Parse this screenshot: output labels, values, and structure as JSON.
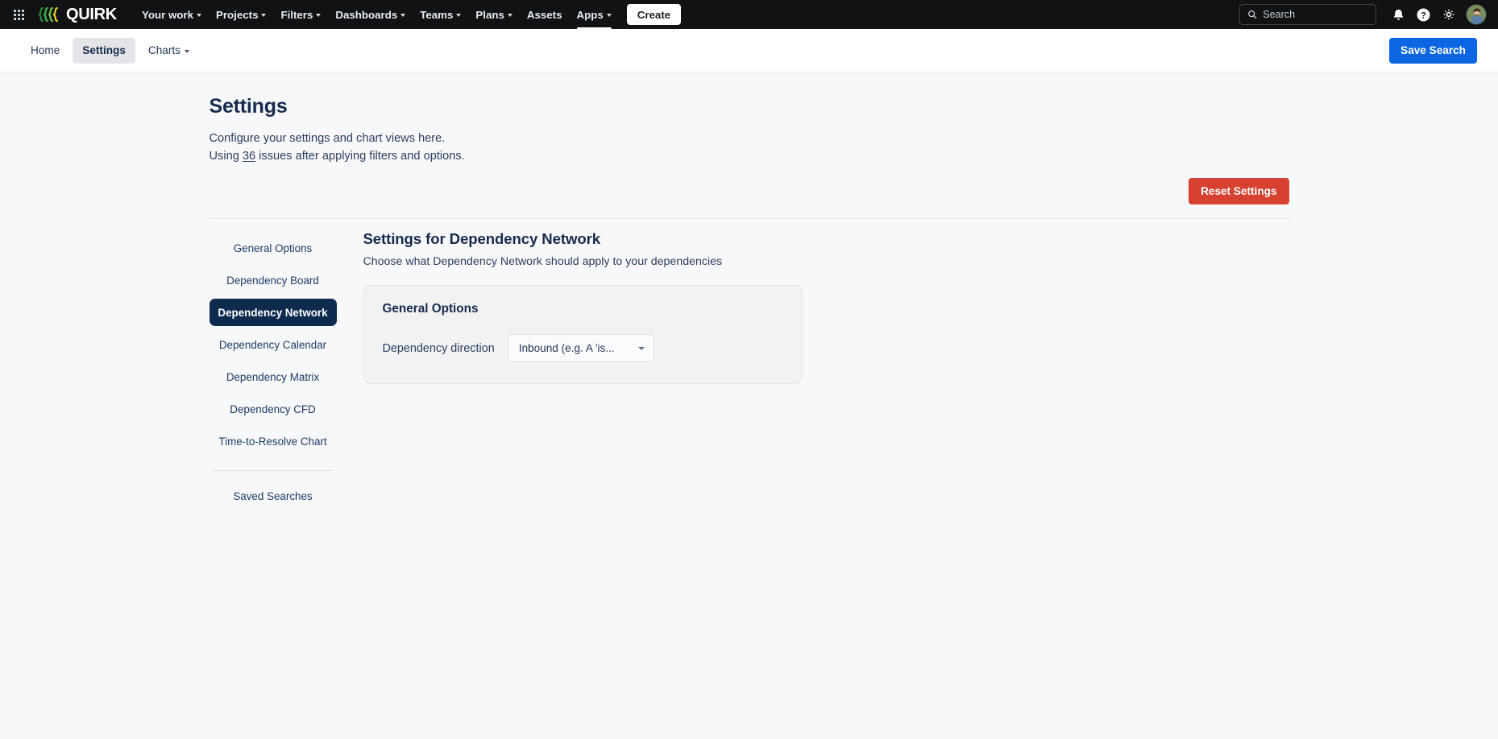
{
  "topnav": {
    "app_switcher_icon": "grid-apps-icon",
    "brand_name": "QUIRK",
    "brand_mark_icon": "quirk-logo-mark",
    "brand_colors": {
      "green": "#3bb143",
      "yellow": "#e8d63a",
      "dark_green": "#1f7a2e"
    },
    "items": [
      {
        "label": "Your work",
        "has_caret": true,
        "active": false
      },
      {
        "label": "Projects",
        "has_caret": true,
        "active": false
      },
      {
        "label": "Filters",
        "has_caret": true,
        "active": false
      },
      {
        "label": "Dashboards",
        "has_caret": true,
        "active": false
      },
      {
        "label": "Teams",
        "has_caret": true,
        "active": false
      },
      {
        "label": "Plans",
        "has_caret": true,
        "active": false
      },
      {
        "label": "Assets",
        "has_caret": false,
        "active": false
      },
      {
        "label": "Apps",
        "has_caret": true,
        "active": true
      }
    ],
    "create_label": "Create",
    "search": {
      "placeholder": "Search",
      "value": "",
      "icon": "search-icon"
    },
    "notifications_icon": "bell-icon",
    "help_icon": "help-circle-icon",
    "settings_icon": "gear-icon",
    "avatar_icon": "user-avatar",
    "background": "#101214"
  },
  "subnav": {
    "items": [
      {
        "label": "Home",
        "has_caret": false,
        "active": false
      },
      {
        "label": "Settings",
        "has_caret": false,
        "active": true
      },
      {
        "label": "Charts",
        "has_caret": true,
        "active": false
      }
    ],
    "save_search_label": "Save Search",
    "save_search_color": "#0c66e4"
  },
  "page": {
    "title": "Settings",
    "description": "Configure your settings and chart views here.",
    "usage_prefix": "Using ",
    "usage_count": "36",
    "usage_suffix": " issues after applying filters and options.",
    "reset_label": "Reset Settings",
    "reset_color": "#d8402f"
  },
  "side_menu": {
    "items": [
      {
        "label": "General Options",
        "active": false
      },
      {
        "label": "Dependency Board",
        "active": false
      },
      {
        "label": "Dependency Network",
        "active": true
      },
      {
        "label": "Dependency Calendar",
        "active": false
      },
      {
        "label": "Dependency Matrix",
        "active": false
      },
      {
        "label": "Dependency CFD",
        "active": false
      },
      {
        "label": "Time-to-Resolve Chart",
        "active": false
      }
    ],
    "footer_items": [
      {
        "label": "Saved Searches",
        "active": false
      }
    ],
    "active_color": "#0e2a4d"
  },
  "settings_panel": {
    "heading": "Settings for Dependency Network",
    "description": "Choose what Dependency Network should apply to your dependencies",
    "card": {
      "title": "General Options",
      "fields": [
        {
          "label": "Dependency direction",
          "value": "Inbound (e.g. A 'is...",
          "control": "dropdown"
        }
      ]
    }
  }
}
